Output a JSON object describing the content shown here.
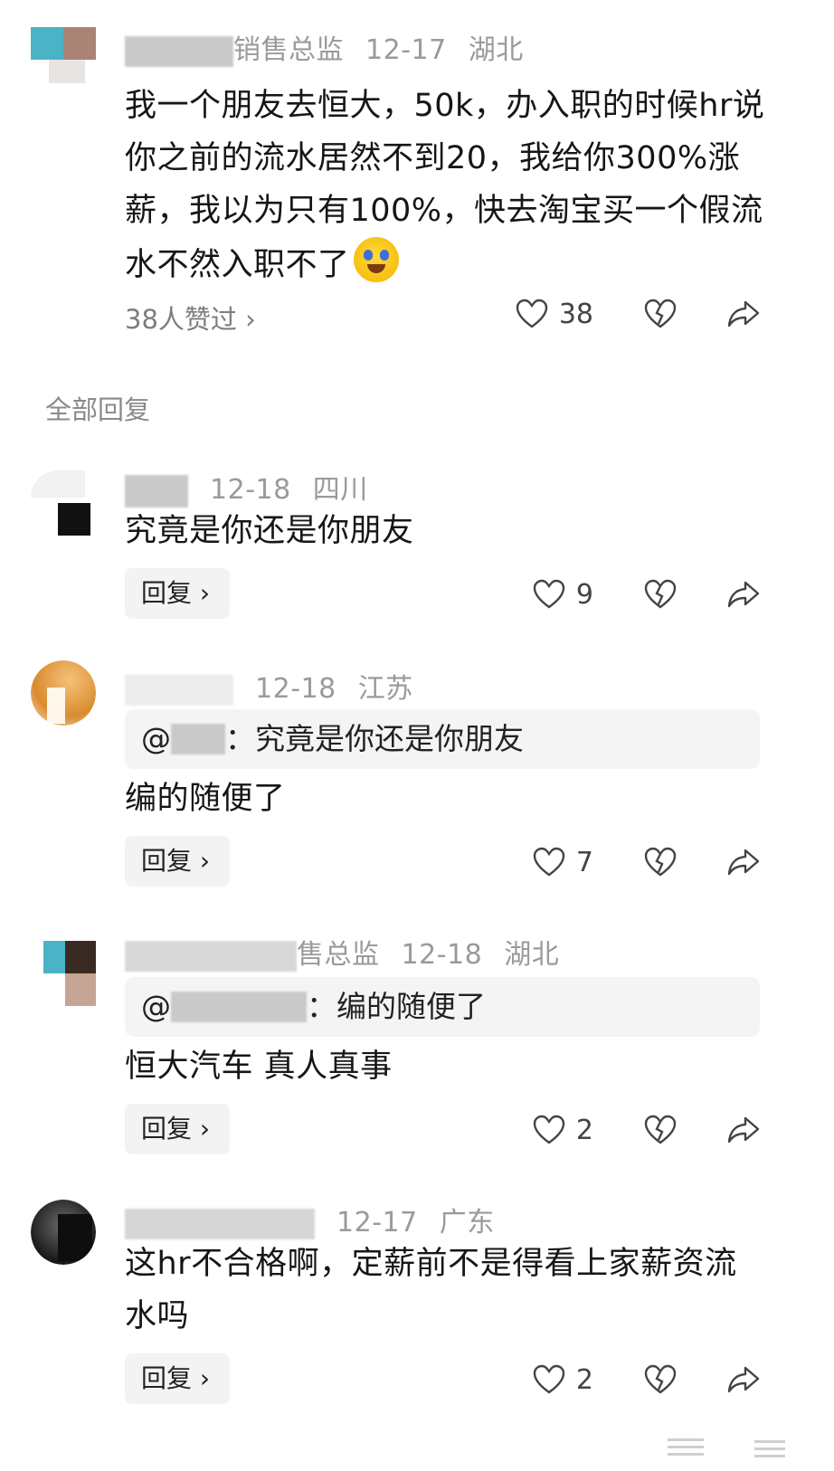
{
  "comment": {
    "author_suffix": "销售总监",
    "date": "12-17",
    "location": "湖北",
    "text": "我一个朋友去恒大，50k，办入职的时候hr说你之前的流水居然不到20，我给你300%涨薪，我以为只有100%，快去淘宝买一个假流水不然入职不了",
    "emoji": "crying-laughing-emoji",
    "likes_link": "38人赞过 ›",
    "like_count": "38"
  },
  "section_title": "全部回复",
  "replies": [
    {
      "date": "12-18",
      "location": "四川",
      "text": "究竟是你还是你朋友",
      "reply_label": "回复 ›",
      "like_count": "9"
    },
    {
      "date": "12-18",
      "location": "江苏",
      "quote_prefix": "@",
      "quote_suffix": "：究竟是你还是你朋友",
      "text": "编的随便了",
      "reply_label": "回复 ›",
      "like_count": "7"
    },
    {
      "author_suffix": "售总监",
      "date": "12-18",
      "location": "湖北",
      "quote_prefix": "@",
      "quote_suffix": "：编的随便了",
      "text": "恒大汽车 真人真事",
      "reply_label": "回复 ›",
      "like_count": "2"
    },
    {
      "date": "12-17",
      "location": "广东",
      "text": "这hr不合格啊，定薪前不是得看上家薪资流水吗",
      "reply_label": "回复 ›",
      "like_count": "2"
    }
  ],
  "colors": {
    "meta_text": "#9a9a9a",
    "body_text": "#161616",
    "quote_bg": "#f4f4f4",
    "reply_btn_bg": "#f3f3f3"
  }
}
